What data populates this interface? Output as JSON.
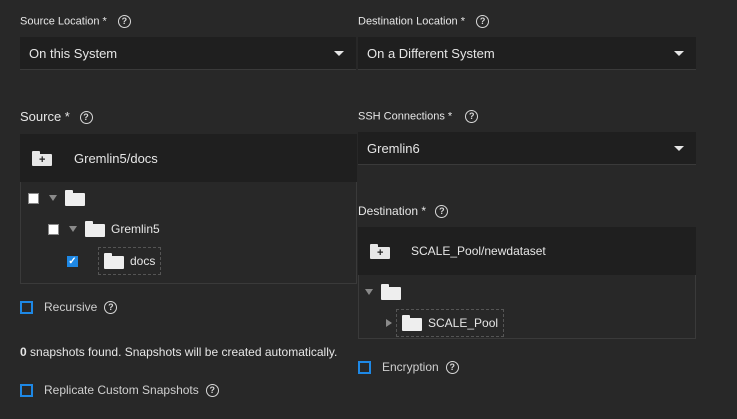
{
  "source_location": {
    "label": "Source Location *",
    "value": "On this System"
  },
  "destination_location": {
    "label": "Destination Location *",
    "value": "On a Different System"
  },
  "source": {
    "label": "Source *",
    "path_value": "Gremlin5/docs",
    "tree": {
      "root_checked": false,
      "child_label": "Gremlin5",
      "child_checked": false,
      "grandchild_label": "docs",
      "grandchild_checked": true
    }
  },
  "ssh_connections": {
    "label": "SSH Connections *",
    "value": "Gremlin6"
  },
  "destination": {
    "label": "Destination *",
    "path_value": "SCALE_Pool/newdataset",
    "tree": {
      "child_label": "SCALE_Pool"
    }
  },
  "recursive": {
    "label": "Recursive",
    "checked": false
  },
  "snapshots_info": {
    "count": "0",
    "text": " snapshots found. Snapshots will be created automatically."
  },
  "replicate_custom_snapshots": {
    "label": "Replicate Custom Snapshots",
    "checked": false
  },
  "encryption": {
    "label": "Encryption",
    "checked": false
  },
  "colors": {
    "background": "#282828",
    "field": "#1f1f1f",
    "accent": "#1e88e5"
  },
  "help_glyph": "?"
}
